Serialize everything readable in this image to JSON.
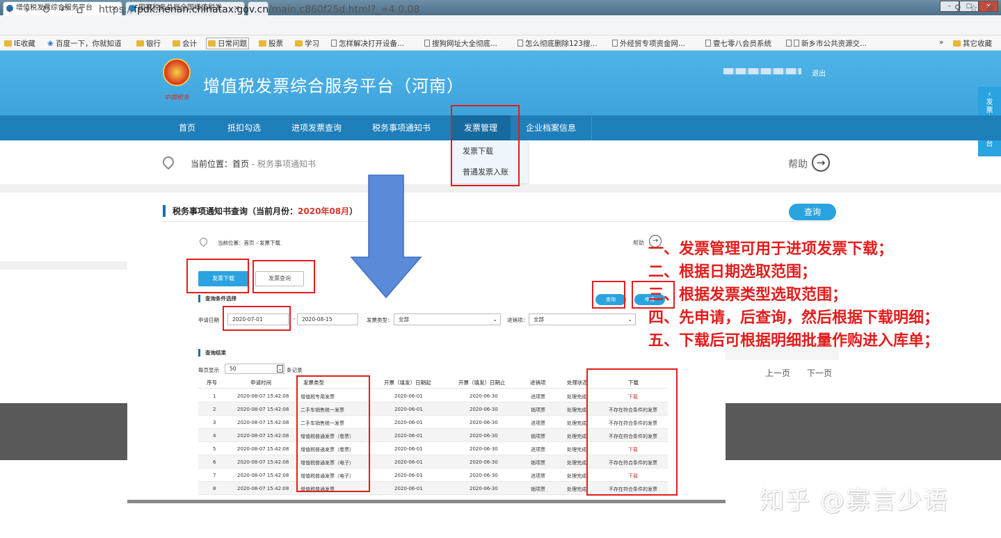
{
  "browser": {
    "tabs": [
      {
        "title": "增值税发票综合服务平台"
      },
      {
        "title": "国家税务总局全国增值税发"
      }
    ],
    "url_prefix": "https://",
    "url_host": "fpdk.henan.chinatax.gov.cn",
    "url_path": "/main.c860f25d.html?_=4.0.08",
    "bookmarks": [
      "IE收藏",
      "百度一下，你就知道",
      "银行",
      "会计",
      "日常问题",
      "股票",
      "学习",
      "怎样解决打开设备...",
      "搜狗网址大全彻底...",
      "怎么彻底删除123搜...",
      "外经贸专项资金网...",
      "壹七零八会员系统",
      "新乡市公共资源交...",
      "其它收藏"
    ]
  },
  "site": {
    "title": "增值税发票综合服务平台（河南）",
    "emblem_text": "中国税务",
    "logout": "退出",
    "side_tab": "发票查验平台",
    "nav": [
      "首页",
      "抵扣勾选",
      "进项发票查询",
      "税务事项通知书",
      "发票管理",
      "企业档案信息"
    ],
    "dropdown": [
      "发票下载",
      "普通发票入账"
    ],
    "breadcrumb_label": "当前位置：首页",
    "breadcrumb_page": " - 税务事项通知书",
    "help": "帮助",
    "query_title": "税务事项通知书查询（当前月份：",
    "query_month": "2020年08月",
    "query_title_end": "）",
    "query_btn": "查询",
    "pager_prev": "上一页",
    "pager_next": "下一页"
  },
  "inset": {
    "breadcrumb": "当前位置：首页 - 发票下载",
    "help": "帮助",
    "btn_download": "发票下载",
    "btn_query": "发票查询",
    "cond_title": "查询条件选择",
    "btn_search": "查询",
    "btn_apply": "申请",
    "date_label": "申请日期",
    "date_from": "2020-07-01",
    "date_to": "2020-08-15",
    "type_label": "发票类型：",
    "type_value": "全部",
    "io_label": "进销项：",
    "io_value": "全部",
    "result_title": "查询结果",
    "per_page_label": "每页显示",
    "per_page": "50",
    "per_page_unit": "条记录",
    "columns": [
      "序号",
      "申请时间",
      "发票类型",
      "开票（填发）日期起",
      "开票（填发）日期止",
      "进销项",
      "处理状态",
      "下载"
    ],
    "rows": [
      [
        "1",
        "2020-08-07 15:42:08",
        "增值税专用发票",
        "2020-06-01",
        "2020-06-30",
        "进项票",
        "处理完成",
        "下载"
      ],
      [
        "2",
        "2020-08-07 15:42:08",
        "二手车销售统一发票",
        "2020-06-01",
        "2020-06-30",
        "销项票",
        "处理完成",
        "不存在符合条件的发票"
      ],
      [
        "3",
        "2020-08-07 15:42:08",
        "二手车销售统一发票",
        "2020-06-01",
        "2020-06-30",
        "进项票",
        "处理完成",
        "不存在符合条件的发票"
      ],
      [
        "4",
        "2020-08-07 15:42:08",
        "增值税普通发票（卷票）",
        "2020-06-01",
        "2020-06-30",
        "销项票",
        "处理完成",
        "不存在符合条件的发票"
      ],
      [
        "5",
        "2020-08-07 15:42:08",
        "增值税普通发票（卷票）",
        "2020-06-01",
        "2020-06-30",
        "进项票",
        "处理完成",
        "下载"
      ],
      [
        "6",
        "2020-08-07 15:42:08",
        "增值税普通发票（电子）",
        "2020-06-01",
        "2020-06-30",
        "销项票",
        "处理完成",
        "不存在符合条件的发票"
      ],
      [
        "7",
        "2020-08-07 15:42:08",
        "增值税普通发票（电子）",
        "2020-06-01",
        "2020-06-30",
        "进项票",
        "处理完成",
        "下载"
      ],
      [
        "8",
        "2020-08-07 15:42:08",
        "增值税普通发票",
        "2020-06-01",
        "2020-06-30",
        "销项票",
        "处理完成",
        "不存在符合条件的发票"
      ]
    ]
  },
  "annotations": [
    "一、发票管理可用于进项发票下载；",
    "二、根据日期选取范围；",
    "三、根据发票类型选取范围；",
    "四、先申请，后查询，然后根据下载明细；",
    "五、下载后可根据明细批量作购进入库单；"
  ],
  "watermark": "知乎 @寡言少语",
  "colors": {
    "header": "#3fa3dc",
    "nav": "#1e7fba",
    "accent": "#2aa3e0",
    "annotation": "#e31c1c"
  }
}
